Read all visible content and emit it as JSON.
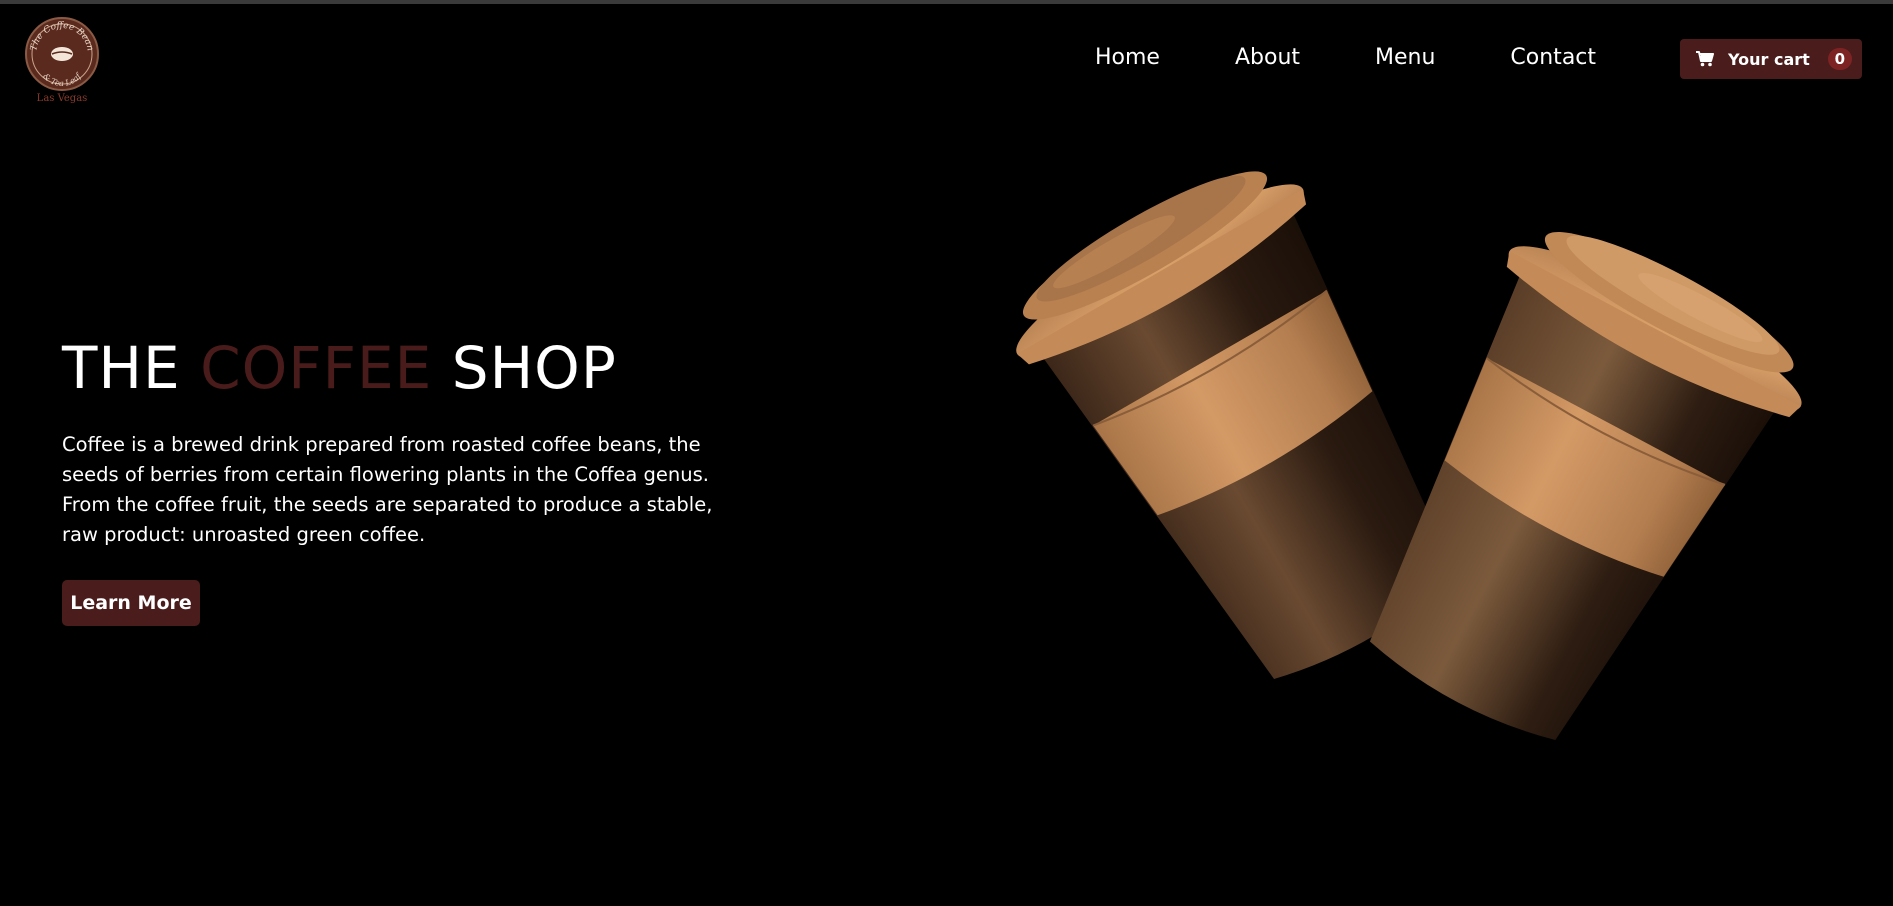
{
  "logo": {
    "name": "coffee-bean-logo",
    "text_top": "The Coffee Bean",
    "text_bottom": "& Tea Leaf",
    "location": "Las Vegas"
  },
  "nav": {
    "items": [
      {
        "label": "Home"
      },
      {
        "label": "About"
      },
      {
        "label": "Menu"
      },
      {
        "label": "Contact"
      }
    ]
  },
  "cart": {
    "icon": "cart-icon",
    "label": "Your cart",
    "count": "0"
  },
  "hero": {
    "title_part1": "THE",
    "title_accent": "COFFEE",
    "title_part2": "SHOP",
    "description": "Coffee is a brewed drink prepared from roasted coffee beans, the seeds of berries from certain flowering plants in the Coffea genus. From the coffee fruit, the seeds are separated to produce a stable, raw product: unroasted green coffee.",
    "button_label": "Learn More"
  },
  "colors": {
    "background": "#000000",
    "accent": "#4a1c1c",
    "badge": "#7d2323",
    "cup_lid": "#c68d5c",
    "cup_body": "#4a3322"
  }
}
